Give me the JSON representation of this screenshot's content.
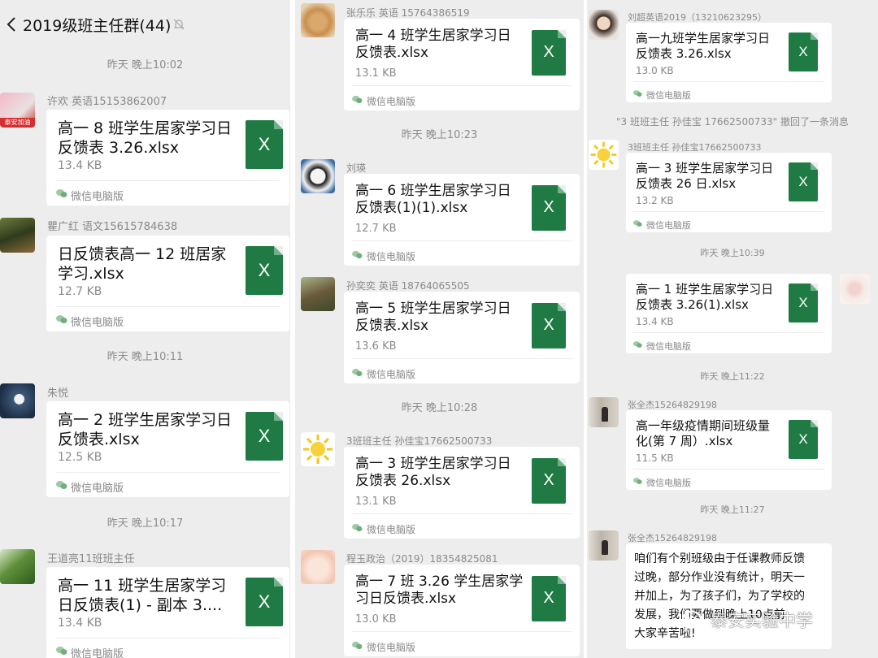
{
  "header": {
    "title": "2019级班主任群(44)",
    "back_icon": "chevron-left-icon",
    "mute_icon": "bell-muted-icon"
  },
  "colors": {
    "chat_bg": "#ededed",
    "bubble_bg": "#ffffff",
    "excel_green": "#1f7b43",
    "meta_gray": "#8c8c8c"
  },
  "file_icon_letter": "X",
  "left": {
    "timestamps": [
      "昨天 晚上10:02",
      "昨天 晚上10:11",
      "昨天 晚上10:17"
    ],
    "messages": [
      {
        "sender": "许欢 英语15153862007",
        "file_name": "高一 8 班学生居家学习日\n反馈表 3.26.xlsx",
        "file_size": "13.4 KB",
        "source": "微信电脑版",
        "avatar_text": "泰安加油"
      },
      {
        "sender": "瞿广红 语文15615784638",
        "file_name": "日反馈表高一 12 班居家\n学习.xlsx",
        "file_size": "12.7 KB",
        "source": "微信电脑版"
      },
      {
        "sender": "朱悦",
        "file_name": "高一 2 班学生居家学习日\n反馈表.xlsx",
        "file_size": "12.5 KB",
        "source": "微信电脑版"
      },
      {
        "sender": "王道亮11班班主任",
        "file_name": "高一 11 班学生居家学习\n日反馈表(1) - 副本 3....",
        "file_size": "13.4 KB",
        "source": "微信电脑版"
      }
    ]
  },
  "mid": {
    "timestamps": [
      "昨天 晚上10:23",
      "昨天 晚上10:28"
    ],
    "messages": [
      {
        "sender": "张乐乐 英语 15764386519",
        "file_name": "高一 4 班学生居家学习日\n反馈表.xlsx",
        "file_size": "13.1 KB",
        "source": "微信电脑版"
      },
      {
        "sender": "刘瑛",
        "file_name": "高一 6 班学生居家学习日\n反馈表(1)(1).xlsx",
        "file_size": "12.7 KB",
        "source": "微信电脑版"
      },
      {
        "sender": "孙奕奕 英语 18764065505",
        "file_name": "高一 5 班学生居家学习日\n反馈表.xlsx",
        "file_size": "13.6 KB",
        "source": "微信电脑版"
      },
      {
        "sender": "3班班主任 孙佳宝17662500733",
        "file_name": "高一 3 班学生居家学习日\n反馈表 26.xlsx",
        "file_size": "13.1 KB",
        "source": "微信电脑版"
      },
      {
        "sender": "程玉政治（2019）18354825081",
        "file_name": "高一 7 班 3.26 学生居家学\n习日反馈表.xlsx",
        "file_size": "13.0 KB",
        "source": "微信电脑版"
      }
    ]
  },
  "right": {
    "timestamps": [
      "昨天 晚上10:39",
      "昨天 晚上11:22",
      "昨天 晚上11:27"
    ],
    "notice": "\"3 班班主任 孙佳宝 17662500733\" 撤回了一条消息",
    "messages": [
      {
        "sender": "刘超英语2019（13210623295）",
        "file_name": "高一九班学生居家学习日\n反馈表 3.26.xlsx",
        "file_size": "13.0 KB",
        "source": "微信电脑版"
      },
      {
        "sender": "3班班主任 孙佳宝17662500733",
        "file_name": "高一 3 班学生居家学习日\n反馈表 26 日.xlsx",
        "file_size": "13.2 KB",
        "source": "微信电脑版"
      },
      {
        "sender": "",
        "file_name": "高一 1 班学生居家学习日\n反馈表 3.26(1).xlsx",
        "file_size": "13.4 KB",
        "source": "微信电脑版"
      },
      {
        "sender": "张全杰15264829198",
        "file_name": "高一年级疫情期间班级量\n化(第 7 周）.xlsx",
        "file_size": "11.5 KB",
        "source": "微信电脑版"
      }
    ],
    "text_message": {
      "sender": "张全杰15264829198",
      "text": "咱们有个别班级由于任课教师反馈\n过晚，部分作业没有统计，明天一\n并加上，为了孩子们，为了学校的\n发展，我们要做到晚上10点前\n大家辛苦啦!"
    }
  },
  "watermark": {
    "text": "泰安实验中学",
    "icon": "wechat-official-account-icon"
  }
}
